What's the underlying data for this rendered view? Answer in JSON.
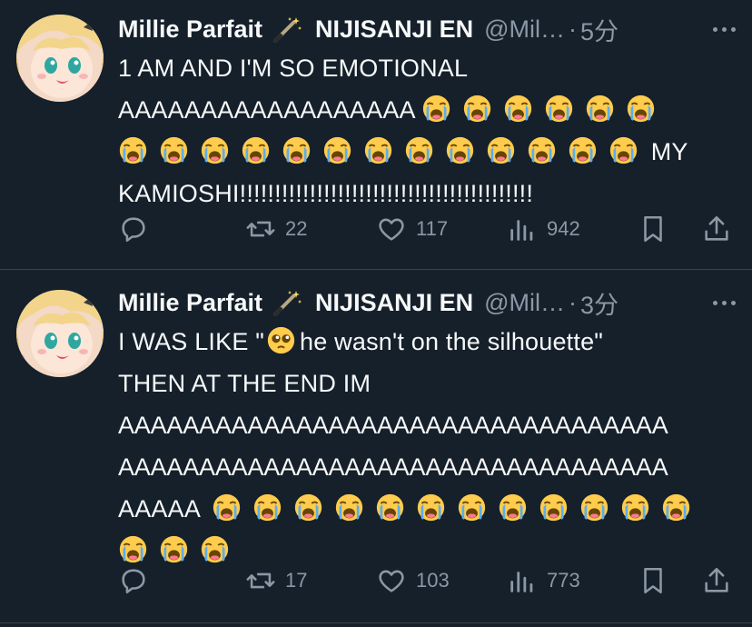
{
  "tweets": [
    {
      "name": "Millie Parfait",
      "name_suffix": "NIJISANJI EN",
      "handle": "@Mil…",
      "separator": "·",
      "time": "5分",
      "body_line1": "1 AM AND I'M SO EMOTIONAL",
      "body_line2": "AAAAAAAAAAAAAAAAAA",
      "body_line3_text": "MY",
      "body_line4": "KAMIOSHI!!!!!!!!!!!!!!!!!!!!!!!!!!!!!!!!!!!!!!!!!!",
      "emoji_name": "loudly-crying-face",
      "retweets": "22",
      "likes": "117",
      "views": "942"
    },
    {
      "name": "Millie Parfait",
      "name_suffix": "NIJISANJI EN",
      "handle": "@Mil…",
      "separator": "·",
      "time": "3分",
      "body_line1a": "I WAS LIKE \"",
      "body_line1b": "he wasn't on the silhouette\"",
      "body_line2": "THEN AT THE END IM",
      "body_line3": "AAAAAAAAAAAAAAAAAAAAAAAAAAAAAAAAAA",
      "body_line4": "AAAAAAAAAAAAAAAAAAAAAAAAAAAAAAAAAA",
      "body_line5_text": "AAAAA",
      "emoji_name": "loudly-crying-face",
      "inline_emoji_name": "pleading-face",
      "retweets": "17",
      "likes": "103",
      "views": "773"
    }
  ],
  "colors": {
    "background": "#15202b",
    "text": "#f7f9f9",
    "muted": "#8b98a5",
    "divider": "#38444d"
  },
  "icons": [
    "reply-icon",
    "retweet-icon",
    "like-icon",
    "views-icon",
    "bookmark-icon",
    "share-icon",
    "more-icon",
    "magic-wand-icon"
  ]
}
